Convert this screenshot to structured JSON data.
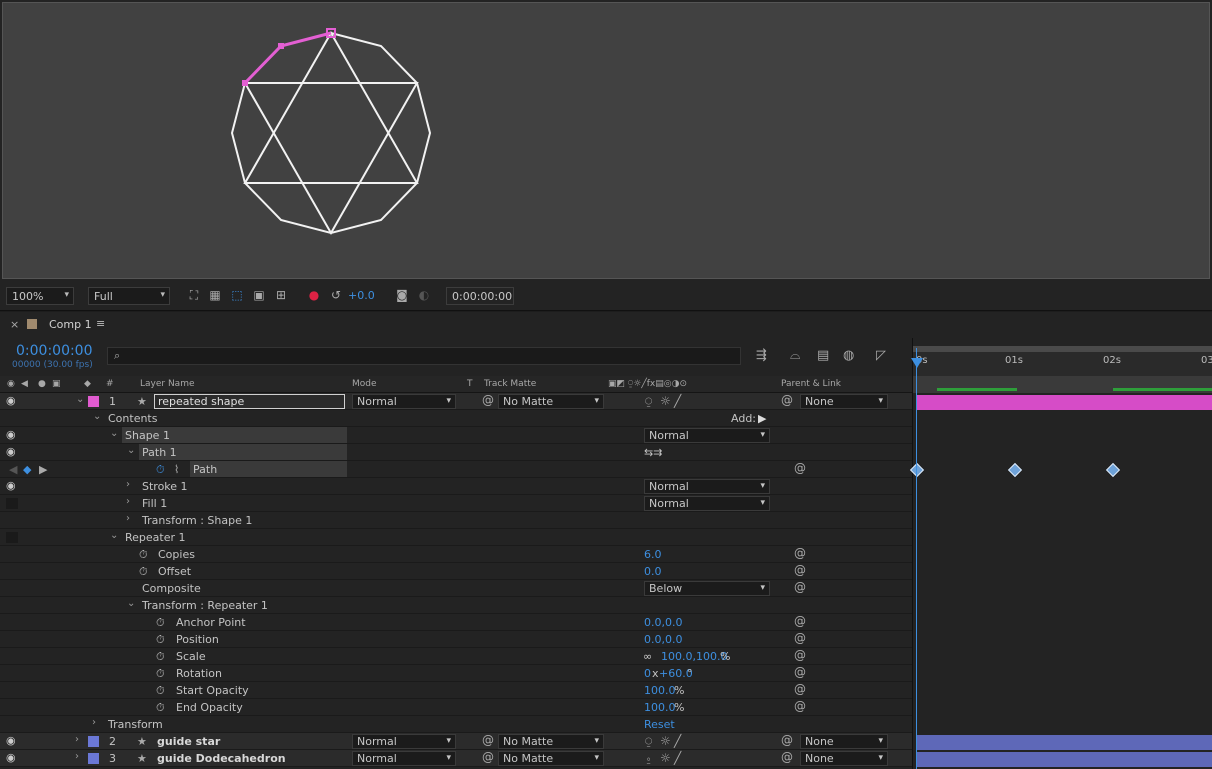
{
  "viewer": {
    "bg": "#414141",
    "zoom": "100%",
    "resolution": "Full",
    "exposure": "+0.0",
    "timecode": "0:00:00:00"
  },
  "tab": {
    "title": "Comp 1",
    "label_color": "#a08a6e"
  },
  "current_time": "0:00:00:00",
  "frame_info": "00000 (30.00 fps)",
  "search": {
    "placeholder": ""
  },
  "columns": {
    "layer_name": "Layer Name",
    "mode": "Mode",
    "t": "T",
    "track_matte": "Track Matte",
    "parent": "Parent & Link",
    "num": "#"
  },
  "ruler": {
    "t0": "0s",
    "t1": "01s",
    "t2": "02s",
    "t3": "03"
  },
  "layers": [
    {
      "num": "1",
      "name": "repeated shape",
      "mode": "Normal",
      "matte": "No Matte",
      "parent": "None",
      "color": "#e15bd0"
    },
    {
      "num": "2",
      "name": "guide star",
      "mode": "Normal",
      "matte": "No Matte",
      "parent": "None",
      "color": "#6b78d6"
    },
    {
      "num": "3",
      "name": "guide Dodecahedron",
      "mode": "Normal",
      "matte": "No Matte",
      "parent": "None",
      "color": "#6b78d6"
    }
  ],
  "props": {
    "contents": "Contents",
    "add": "Add:",
    "shape1": "Shape 1",
    "shape1_mode": "Normal",
    "path1": "Path 1",
    "path": "Path",
    "stroke1": "Stroke 1",
    "stroke1_mode": "Normal",
    "fill1": "Fill 1",
    "fill1_mode": "Normal",
    "transform_shape": "Transform : Shape 1",
    "repeater1": "Repeater 1",
    "copies": "Copies",
    "copies_val": "6.0",
    "offset": "Offset",
    "offset_val": "0.0",
    "composite": "Composite",
    "composite_val": "Below",
    "transform_rep": "Transform : Repeater 1",
    "anchor": "Anchor Point",
    "anchor_val": "0.0,0.0",
    "position": "Position",
    "position_val": "0.0,0.0",
    "scale": "Scale",
    "scale_val": "100.0,100.0",
    "scale_unit": "%",
    "rotation": "Rotation",
    "rotation_rev": "0",
    "rotation_x": "x",
    "rotation_val": "+60.0",
    "rotation_unit": "°",
    "start_op": "Start Opacity",
    "start_op_val": "100.0",
    "end_op": "End Opacity",
    "end_op_val": "100.0",
    "op_unit": "%",
    "transform": "Transform",
    "reset": "Reset"
  }
}
